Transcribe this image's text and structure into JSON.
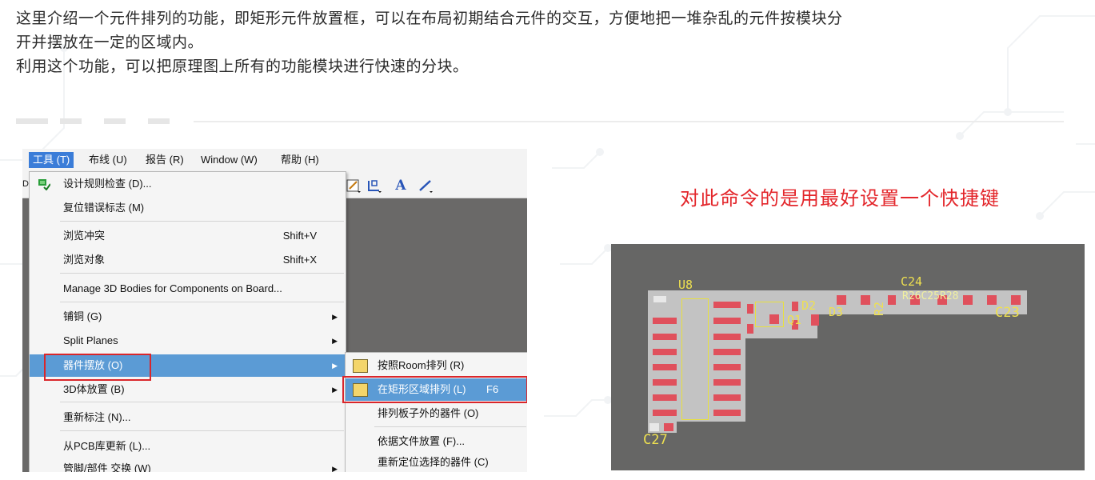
{
  "intro": {
    "line1": "这里介绍一个元件排列的功能，即矩形元件放置框，可以在布局初期结合元件的交互，方便地把一堆杂乱的元件按模块分",
    "line2": "开并摆放在一定的区域内。",
    "line3": "利用这个功能，可以把原理图上所有的功能模块进行快速的分块。"
  },
  "menubar": {
    "items": [
      "工具 (T)",
      "布线 (U)",
      "报告 (R)",
      "Window (W)",
      "帮助 (H)"
    ],
    "side_letter": "D"
  },
  "toolbar_icons": [
    "pencil-icon",
    "insert-icon",
    "text-A-icon",
    "line-icon"
  ],
  "toolbar_text": "A",
  "tools_menu": {
    "items": [
      {
        "label": "设计规则检查 (D)...",
        "shortcut": "",
        "submenu": false
      },
      {
        "label": "复位错误标志 (M)",
        "shortcut": "",
        "submenu": false
      },
      {
        "label": "浏览冲突",
        "shortcut": "Shift+V",
        "submenu": false
      },
      {
        "label": "浏览对象",
        "shortcut": "Shift+X",
        "submenu": false
      },
      {
        "label": "Manage 3D Bodies for Components on Board...",
        "shortcut": "",
        "submenu": false
      },
      {
        "label": "铺铜 (G)",
        "shortcut": "",
        "submenu": true
      },
      {
        "label": "Split Planes",
        "shortcut": "",
        "submenu": true
      },
      {
        "label": "器件摆放 (O)",
        "shortcut": "",
        "submenu": true
      },
      {
        "label": "3D体放置 (B)",
        "shortcut": "",
        "submenu": true
      },
      {
        "label": "重新标注 (N)...",
        "shortcut": "",
        "submenu": false
      },
      {
        "label": "从PCB库更新 (L)...",
        "shortcut": "",
        "submenu": false
      },
      {
        "label": "管脚/部件 交换 (W)",
        "shortcut": "",
        "submenu": true
      }
    ]
  },
  "submenu": {
    "items": [
      {
        "label": "按照Room排列 (R)",
        "shortcut": ""
      },
      {
        "label": "在矩形区域排列 (L)",
        "shortcut": "F6"
      },
      {
        "label": "排列板子外的器件 (O)",
        "shortcut": ""
      },
      {
        "label": "依据文件放置 (F)...",
        "shortcut": ""
      },
      {
        "label": "重新定位选择的器件 (C)",
        "shortcut": ""
      }
    ]
  },
  "caption": "对此命令的是用最好设置一个快捷键",
  "pcb": {
    "labels": {
      "u8": "U8",
      "c24": "C24",
      "c23": "C23",
      "c27": "C27",
      "d2": "D2",
      "q1": "Q1",
      "d3": "D3",
      "r2": "R2",
      "row": "R26C25R28"
    }
  },
  "colors": {
    "highlight": "#5b9bd5",
    "menubar_active": "#3b7dd8",
    "annotation_red": "#d9262b",
    "caption_red": "#e3262b",
    "pcb_background": "#666665",
    "pad_red": "#e0505c",
    "silkscreen_yellow": "#eee050"
  }
}
